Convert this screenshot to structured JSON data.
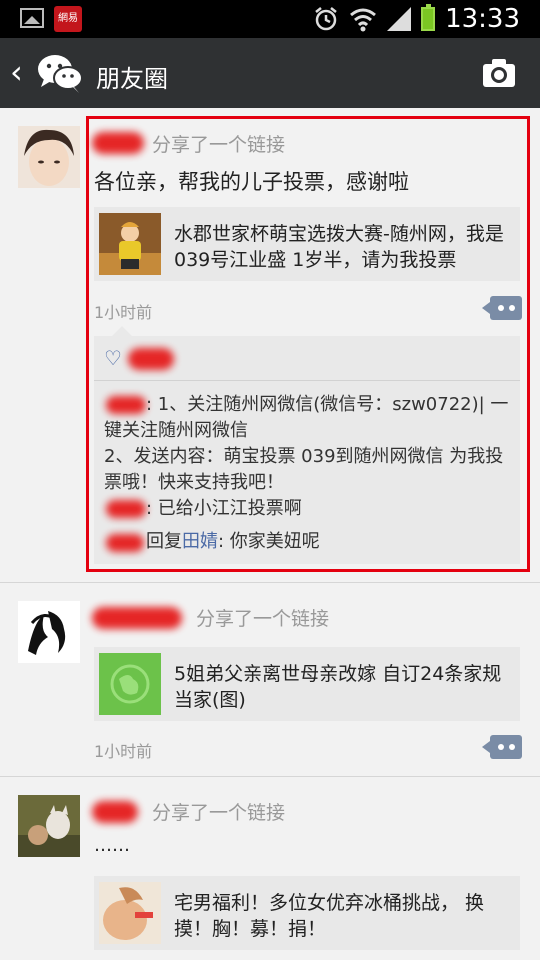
{
  "status_bar": {
    "time": "13:33",
    "app_badge": "網易",
    "icons": [
      "image-icon",
      "netease-app-icon",
      "alarm-icon",
      "wifi-icon",
      "signal-icon",
      "battery-icon"
    ]
  },
  "nav": {
    "title": "朋友圈",
    "back_icon": "chevron-left-icon",
    "logo_icon": "wechat-logo-icon",
    "camera_icon": "camera-icon"
  },
  "posts": [
    {
      "shared_label": "分享了一个链接",
      "text": "各位亲，帮我的儿子投票，感谢啦",
      "link_title": "水郡世家杯萌宝选拨大赛-随州网，我是039号江业盛 1岁半，请为我投票",
      "time": "1小时前",
      "comments": [
        {
          "text": ": 1、关注随州网微信(微信号：szw0722)| 一键关注随州网微信\n2、发送内容：萌宝投票 039到随州网微信 为我投票哦！快来支持我吧！"
        },
        {
          "text": ": 已给小江江投票啊"
        },
        {
          "reply_word": "回复",
          "reply_to": "田婧",
          "text": ": 你家美妞呢"
        }
      ]
    },
    {
      "shared_label": "分享了一个链接",
      "link_title": "5姐弟父亲离世母亲改嫁 自订24条家规当家(图)",
      "time": "1小时前"
    },
    {
      "shared_label": "分享了一个链接",
      "text": "……",
      "link_title": "宅男福利！多位女优弃冰桶挑战， 换摸！胸！募！捐！"
    }
  ],
  "colors": {
    "nav_bg": "#2f3133",
    "highlight": "#e4000f",
    "link_name": "#4b6aa6",
    "comment_btn": "#7a8ca6"
  }
}
